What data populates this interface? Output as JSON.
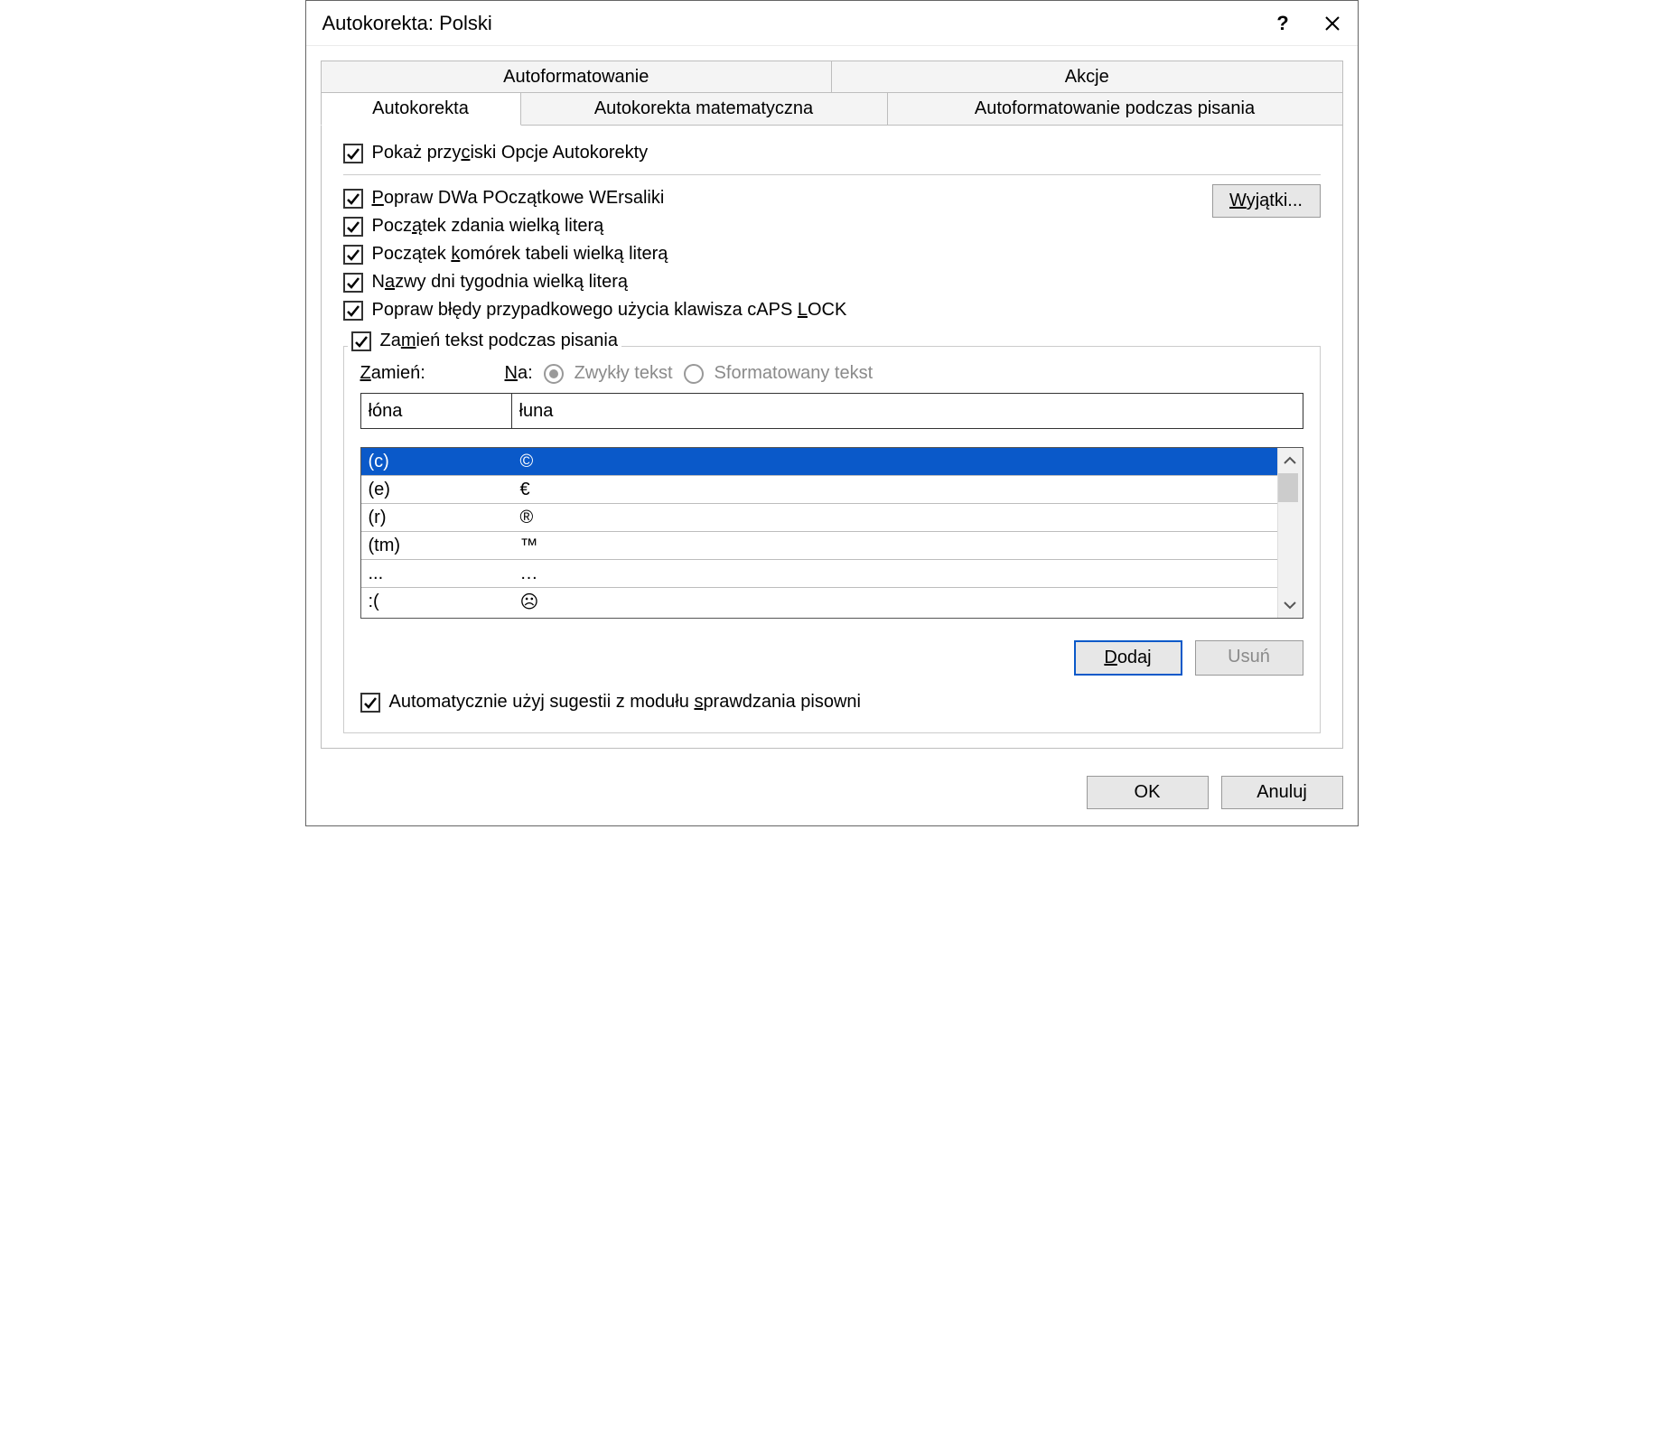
{
  "title": "Autokorekta: Polski",
  "tabs_top": {
    "autoformat": "Autoformatowanie",
    "actions": "Akcje"
  },
  "tabs_bottom": {
    "autocorrect": "Autokorekta",
    "math_autocorrect": "Autokorekta matematyczna",
    "autoformat_typing": "Autoformatowanie podczas pisania"
  },
  "checks": {
    "show_buttons_pre": "Pokaż przy",
    "show_buttons_ul": "c",
    "show_buttons_post": "iski Opcje Autokorekty",
    "two_caps_ul": "P",
    "two_caps_post": "opraw DWa POczątkowe WErsaliki",
    "cap_sentence_pre": "Pocz",
    "cap_sentence_ul": "ą",
    "cap_sentence_post": "tek zdania wielką literą",
    "cap_cells_pre": "Początek ",
    "cap_cells_ul": "k",
    "cap_cells_post": "omórek tabeli wielką literą",
    "cap_days_pre": "N",
    "cap_days_ul": "a",
    "cap_days_post": "zwy dni tygodnia wielką literą",
    "caps_lock_pre": "Popraw błędy przypadkowego użycia klawisza cAPS ",
    "caps_lock_ul": "L",
    "caps_lock_post": "OCK",
    "spell_pre": "Automatycznie użyj sugestii z modułu ",
    "spell_ul": "s",
    "spell_post": "prawdzania pisowni"
  },
  "exceptions_pre": "",
  "exceptions_ul": "W",
  "exceptions_post": "yjątki...",
  "replace_section": {
    "legend_pre": "Za",
    "legend_ul": "m",
    "legend_post": "ień tekst podczas pisania",
    "replace_label_ul": "Z",
    "replace_label_post": "amień:",
    "with_label_ul": "N",
    "with_label_post": "a:",
    "radio_plain": "Zwykły tekst",
    "radio_formatted": "Sformatowany tekst",
    "replace_value": "łóna",
    "with_value": "łuna",
    "rows": [
      {
        "from": "(c)",
        "to": "©"
      },
      {
        "from": "(e)",
        "to": "€"
      },
      {
        "from": "(r)",
        "to": "®"
      },
      {
        "from": "(tm)",
        "to": "™"
      },
      {
        "from": "...",
        "to": "…"
      },
      {
        "from": ":(",
        "to": "☹"
      }
    ],
    "add_ul": "D",
    "add_post": "odaj",
    "delete": "Usuń"
  },
  "footer": {
    "ok": "OK",
    "cancel": "Anuluj"
  }
}
